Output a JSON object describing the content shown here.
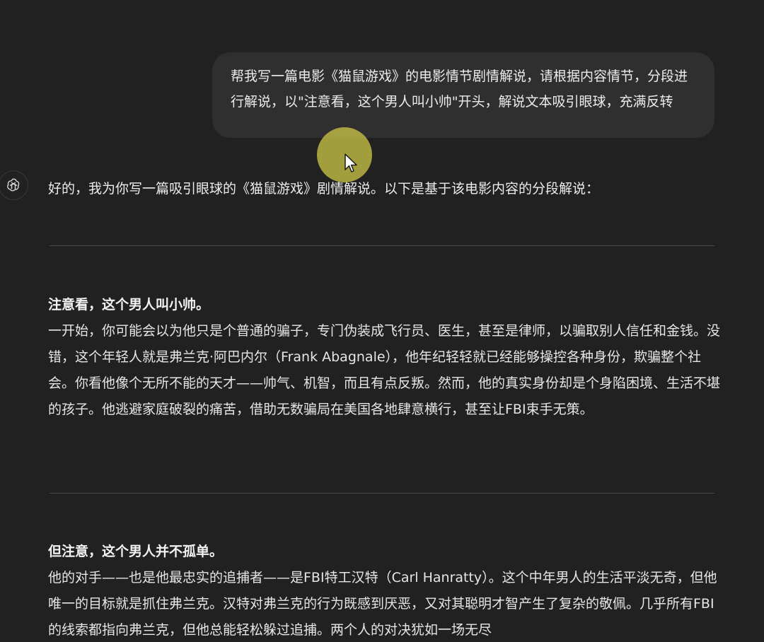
{
  "user_message": {
    "text": "帮我写一篇电影《猫鼠游戏》的电影情节剧情解说，请根据内容情节，分段进行解说，以\"注意看，这个男人叫小帅\"开头，解说文本吸引眼球，充满反转"
  },
  "assistant": {
    "avatar_icon": "openai-logo-icon",
    "intro": "好的，我为你写一篇吸引眼球的《猫鼠游戏》剧情解说。以下是基于该电影内容的分段解说：",
    "sections": [
      {
        "heading": "注意看，这个男人叫小帅。",
        "body": "一开始，你可能会以为他只是个普通的骗子，专门伪装成飞行员、医生，甚至是律师，以骗取别人信任和金钱。没错，这个年轻人就是弗兰克·阿巴内尔（Frank Abagnale），他年纪轻轻就已经能够操控各种身份，欺骗整个社会。你看他像个无所不能的天才——帅气、机智，而且有点反叛。然而，他的真实身份却是个身陷困境、生活不堪的孩子。他逃避家庭破裂的痛苦，借助无数骗局在美国各地肆意横行，甚至让FBI束手无策。"
      },
      {
        "heading": "但注意，这个男人并不孤单。",
        "body": "他的对手——也是他最忠实的追捕者——是FBI特工汉特（Carl Hanratty）。这个中年男人的生活平淡无奇，但他唯一的目标就是抓住弗兰克。汉特对弗兰克的行为既感到厌恶，又对其聪明才智产生了复杂的敬佩。几乎所有FBI的线索都指向弗兰克，但他总能轻松躲过追捕。两个人的对决犹如一场无尽"
      }
    ]
  },
  "colors": {
    "background": "#212121",
    "bubble": "#2f2f2f",
    "text": "#ececec",
    "divider": "#4a4a4a",
    "cursor_highlight": "#d6ce48"
  }
}
